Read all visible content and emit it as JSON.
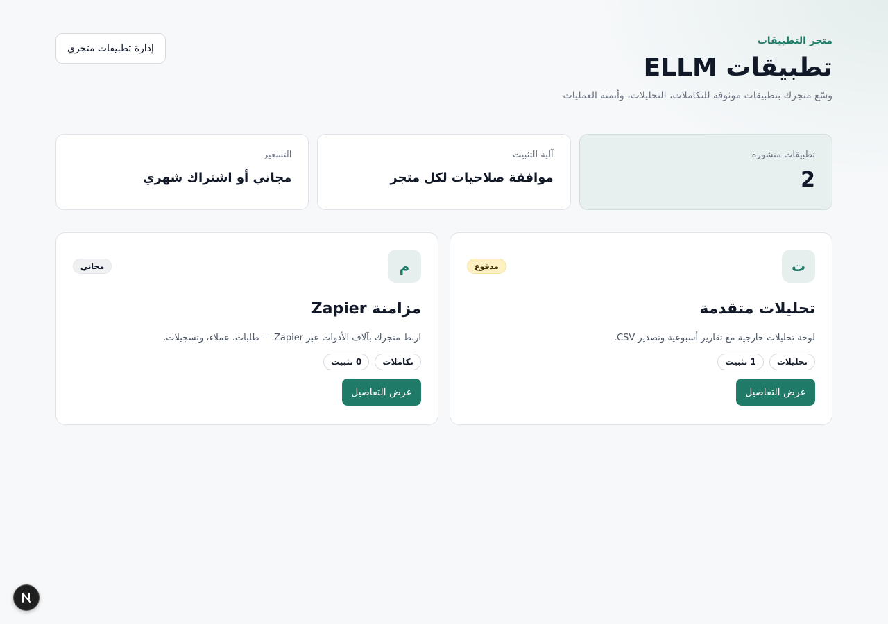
{
  "header": {
    "eyebrow": "متجر التطبيقات",
    "title": "تطبيقات ELLM",
    "subtitle": "وسّع متجرك بتطبيقات موثوقة للتكاملات، التحليلات، وأتمتة العمليات",
    "manage_button": "إدارة تطبيقات متجري"
  },
  "stats": [
    {
      "label": "تطبيقات منشورة",
      "value": "2"
    },
    {
      "label": "آلية التثبيت",
      "value": "موافقة صلاحيات لكل متجر"
    },
    {
      "label": "التسعير",
      "value": "مجاني أو اشتراك شهري"
    }
  ],
  "apps": [
    {
      "avatar": "ت",
      "badge": "مدفوع",
      "title": "تحليلات متقدمة",
      "description": "لوحة تحليلات خارجية مع تقارير أسبوعية وتصدير CSV.",
      "category": "تحليلات",
      "installs": "1 تثبيت",
      "button": "عرض التفاصيل"
    },
    {
      "avatar": "م",
      "badge": "مجاني",
      "title": "مزامنة Zapier",
      "description": "اربط متجرك بآلاف الأدوات عبر Zapier — طلبات، عملاء، وتسجيلات.",
      "category": "تكاملات",
      "installs": "0 تثبيت",
      "button": "عرض التفاصيل"
    }
  ],
  "dev_indicator": {
    "icon": "next-logo-icon"
  }
}
